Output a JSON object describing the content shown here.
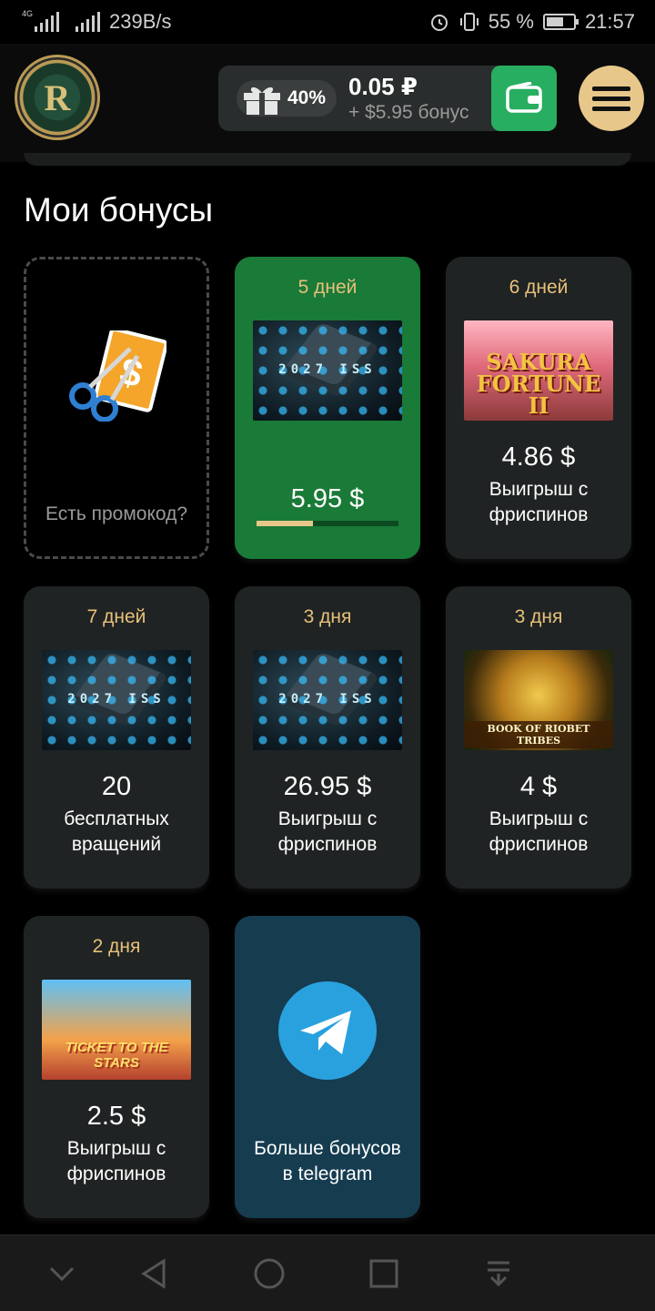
{
  "status_bar": {
    "network_type": "4G",
    "speed": "239B/s",
    "battery": "55 %",
    "time": "21:57"
  },
  "header": {
    "logo_letter": "R",
    "gift_percent": "40%",
    "balance": "0.05 ₽",
    "bonus_balance": "+ $5.95 бонус"
  },
  "page_title": "Мои бонусы",
  "promo": {
    "label": "Есть промокод?"
  },
  "cards": [
    {
      "days": "5 дней",
      "game": "2027 ISS",
      "amount": "5.95 $",
      "progress": 0.4
    },
    {
      "days": "6 дней",
      "game": "SAKURA FORTUNE II",
      "amount": "4.86 $",
      "desc_line1": "Выигрыш с",
      "desc_line2": "фриспинов"
    },
    {
      "days": "7 дней",
      "game": "2027 ISS",
      "amount": "20",
      "desc_line1": "бесплатных",
      "desc_line2": "вращений"
    },
    {
      "days": "3 дня",
      "game": "2027 ISS",
      "amount": "26.95 $",
      "desc_line1": "Выигрыш с",
      "desc_line2": "фриспинов"
    },
    {
      "days": "3 дня",
      "game": "BOOK OF RIOBET TRIBES",
      "amount": "4 $",
      "desc_line1": "Выигрыш с",
      "desc_line2": "фриспинов"
    },
    {
      "days": "2 дня",
      "game": "TICKET TO THE STARS",
      "amount": "2.5 $",
      "desc_line1": "Выигрыш с",
      "desc_line2": "фриспинов"
    }
  ],
  "telegram": {
    "line1": "Больше бонусов",
    "line2": "в telegram"
  },
  "colors": {
    "accent_gold": "#e8c78b",
    "wallet_green": "#27ae60",
    "active_card": "#1a7a37",
    "telegram_blue": "#2aa1df"
  }
}
